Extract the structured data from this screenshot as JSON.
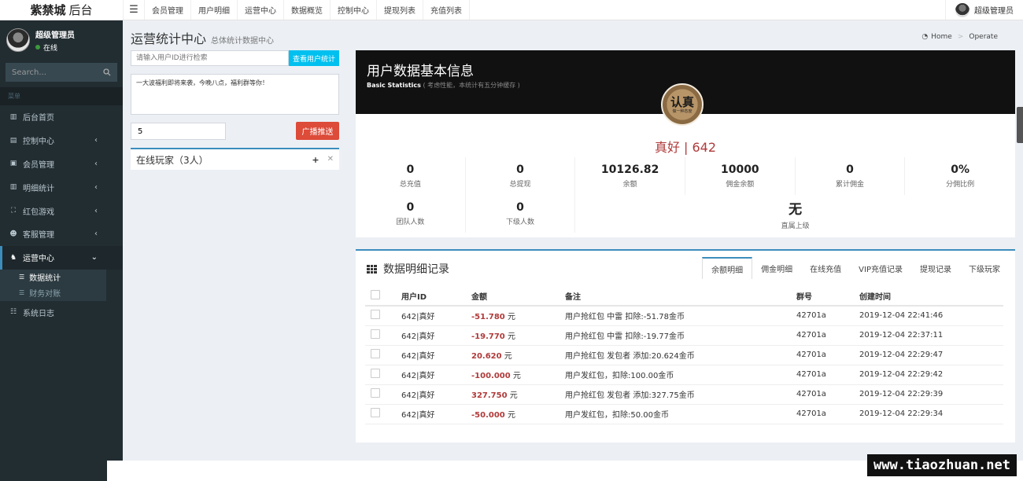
{
  "header": {
    "logo_bold": "紫禁城",
    "logo_rest": "后台",
    "nav": [
      "会员管理",
      "用户明细",
      "运营中心",
      "数据概览",
      "控制中心",
      "提现列表",
      "充值列表"
    ],
    "user": "超级管理员"
  },
  "sidebar": {
    "user_name": "超级管理员",
    "status": "在线",
    "search_placeholder": "Search...",
    "section_label": "菜单",
    "items": [
      {
        "label": "后台首页",
        "icon": "bar-chart-icon"
      },
      {
        "label": "控制中心",
        "icon": "server-icon"
      },
      {
        "label": "会员管理",
        "icon": "id-card-icon"
      },
      {
        "label": "明细统计",
        "icon": "bar-chart-icon"
      },
      {
        "label": "红包游戏",
        "icon": "expand-icon"
      },
      {
        "label": "客服管理",
        "icon": "users-icon"
      },
      {
        "label": "运营中心",
        "icon": "medal-icon"
      },
      {
        "label": "系统日志",
        "icon": "database-icon"
      }
    ],
    "sub_items": [
      "数据统计",
      "财务对账"
    ]
  },
  "page": {
    "title": "运营统计中心",
    "subtitle": "总体统计数据中心",
    "breadcrumb_home": "Home",
    "breadcrumb_current": "Operate"
  },
  "left": {
    "uid_placeholder": "请输入用户ID进行检索",
    "uid_button": "查看用户统计",
    "message": "一大波福利即将来袭，今晚八点，福利群等你！",
    "count": "5",
    "push_button": "广播推送",
    "online_title": "在线玩家（3人）"
  },
  "profile": {
    "title": "用户数据基本信息",
    "sub_en": "Basic Statistics",
    "sub_note": "( 考虑性能，本统计有五分钟缓存 )",
    "badge_text": "认真",
    "badge_sub": "做一种态度",
    "name": "真好 | 642",
    "stats": [
      {
        "value": "0",
        "label": "总充值"
      },
      {
        "value": "0",
        "label": "总提现"
      },
      {
        "value": "10126.82",
        "label": "余额"
      },
      {
        "value": "10000",
        "label": "佣金余额"
      },
      {
        "value": "0",
        "label": "累计佣金"
      },
      {
        "value": "0%",
        "label": "分佣比例"
      },
      {
        "value": "0",
        "label": "团队人数"
      },
      {
        "value": "0",
        "label": "下级人数"
      },
      {
        "value": "无",
        "label": "直属上级"
      }
    ]
  },
  "detail": {
    "title": "数据明细记录",
    "tabs": [
      "余额明细",
      "佣金明细",
      "在线充值",
      "VIP充值记录",
      "提现记录",
      "下级玩家"
    ],
    "columns": [
      "用户ID",
      "金额",
      "备注",
      "群号",
      "创建时间"
    ],
    "unit": "元",
    "rows": [
      {
        "uid": "642|真好",
        "amount": "-51.780",
        "note": "用户抢红包 中雷 扣除:-51.78金币",
        "group": "42701a",
        "time": "2019-12-04 22:41:46"
      },
      {
        "uid": "642|真好",
        "amount": "-19.770",
        "note": "用户抢红包 中雷 扣除:-19.77金币",
        "group": "42701a",
        "time": "2019-12-04 22:37:11"
      },
      {
        "uid": "642|真好",
        "amount": "20.620",
        "note": "用户抢红包 发包者 添加:20.624金币",
        "group": "42701a",
        "time": "2019-12-04 22:29:47"
      },
      {
        "uid": "642|真好",
        "amount": "-100.000",
        "note": "用户发红包，扣除:100.00金币",
        "group": "42701a",
        "time": "2019-12-04 22:29:42"
      },
      {
        "uid": "642|真好",
        "amount": "327.750",
        "note": "用户抢红包 发包者 添加:327.75金币",
        "group": "42701a",
        "time": "2019-12-04 22:29:39"
      },
      {
        "uid": "642|真好",
        "amount": "-50.000",
        "note": "用户发红包，扣除:50.00金币",
        "group": "42701a",
        "time": "2019-12-04 22:29:34"
      }
    ]
  },
  "watermark": "www.tiaozhuan.net",
  "colors": {
    "accent": "#3c8dbc",
    "danger": "#dd4b39",
    "info": "#00c0ef",
    "sidebar": "#222d32"
  }
}
